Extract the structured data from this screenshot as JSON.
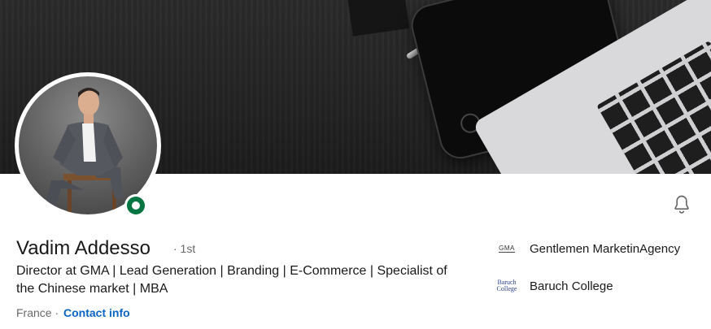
{
  "profile": {
    "name": "Vadim Addesso",
    "degree": "· 1st",
    "headline": "Director at GMA | Lead Generation | Branding | E-Commerce | Specialist of the Chinese market | MBA",
    "location": "France ·",
    "contact_label": "Contact info"
  },
  "experience": [
    {
      "logo_text": "GMA",
      "label": "Gentlemen MarketinAgency",
      "icon": "gma-logo-icon"
    },
    {
      "logo_text": "Baruch College",
      "label": "Baruch College",
      "icon": "baruch-logo-icon"
    }
  ],
  "icons": {
    "notify": "bell-icon",
    "status": "online-status-icon"
  },
  "colors": {
    "link": "#0a66c2",
    "online": "#057642",
    "banner": "#232323"
  }
}
